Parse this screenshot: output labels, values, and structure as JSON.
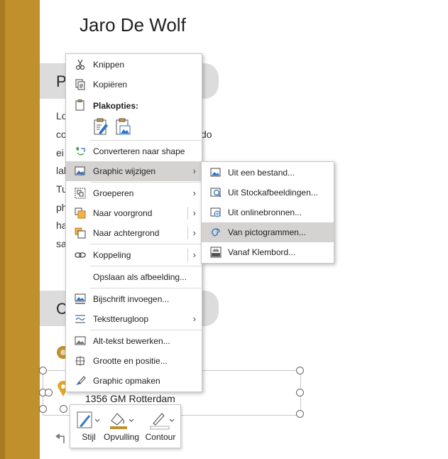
{
  "document": {
    "name": "Jaro De Wolf",
    "section_letter_1": "P",
    "section_letter_2": "C",
    "text_fragments": [
      "Lo",
      "co",
      "ei",
      "lal",
      "Tu",
      "ph",
      "ha",
      "sa"
    ],
    "text_fragment_right": "do",
    "address": "1356 GM Rotterdam"
  },
  "context_menu": {
    "items": {
      "cut": "Knippen",
      "copy": "Kopiëren",
      "paste_options": "Plakopties:",
      "convert": "Converteren naar shape",
      "change_graphic": "Graphic wijzigen",
      "group": "Groeperen",
      "bring_forward": "Naar voorgrond",
      "send_backward": "Naar achtergrond",
      "link": "Koppeling",
      "save_as_image": "Opslaan als afbeelding...",
      "insert_caption": "Bijschrift invoegen...",
      "wrap_text": "Tekstterugloop",
      "edit_alt_text": "Alt-tekst bewerken...",
      "size_position": "Grootte en positie...",
      "format_graphic": "Graphic opmaken"
    }
  },
  "submenu": {
    "items": {
      "from_file": "Uit een bestand...",
      "from_stock": "Uit Stockafbeeldingen...",
      "from_online": "Uit onlinebronnen...",
      "from_icons": "Van pictogrammen...",
      "from_clipboard": "Vanaf Klembord..."
    }
  },
  "mini_toolbar": {
    "style": "Stijl",
    "fill": "Opvulling",
    "outline": "Contour"
  },
  "colors": {
    "accent_gold": "#bf902c",
    "highlight": "#d5d3d1",
    "pill_gray": "#dcdcdc"
  }
}
